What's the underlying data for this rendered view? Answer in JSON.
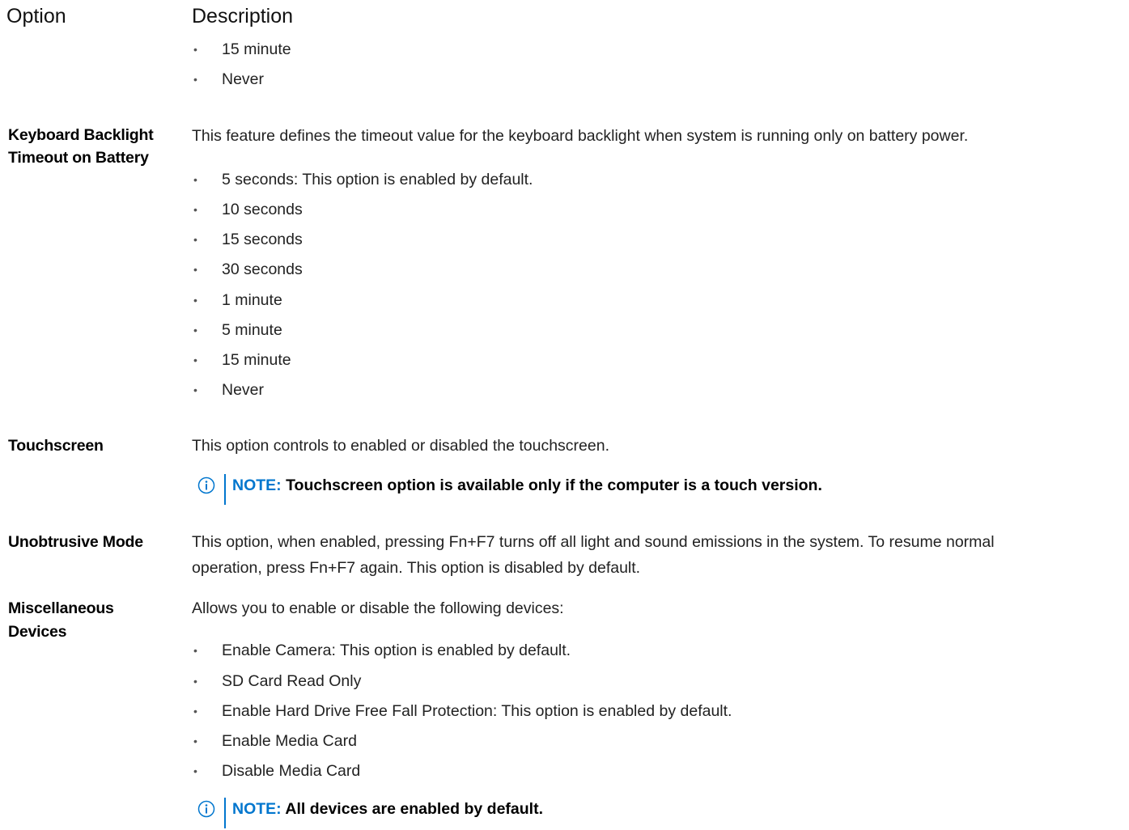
{
  "header": {
    "option": "Option",
    "description": "Description"
  },
  "top_bullets": [
    "15 minute",
    "Never"
  ],
  "rows": [
    {
      "option_lines": [
        "Keyboard Backlight",
        "Timeout on Battery"
      ],
      "description": "This feature defines the timeout value for the keyboard backlight when system is running only on battery power.",
      "bullets": [
        "5 seconds: This option is enabled by default.",
        "10 seconds",
        "15 seconds",
        "30 seconds",
        "1 minute",
        "5 minute",
        "15 minute",
        "Never"
      ]
    },
    {
      "option_lines": [
        "Touchscreen"
      ],
      "description": "This option controls to enabled or disabled the touchscreen.",
      "note": {
        "label": "NOTE:",
        "text": "Touchscreen option is available only if the computer is a touch version."
      }
    },
    {
      "option_lines": [
        "Unobtrusive Mode"
      ],
      "description_lines": [
        "This option, when enabled, pressing Fn+F7 turns off all light and sound emissions in the system. To resume normal",
        "operation, press Fn+F7 again. This option is disabled by default."
      ]
    },
    {
      "option_lines": [
        "Miscellaneous",
        "Devices"
      ],
      "description": "Allows you to enable or disable the following devices:",
      "bullets": [
        "Enable Camera: This option is enabled by default.",
        "SD Card Read Only",
        "Enable Hard Drive Free Fall Protection: This option is enabled by default.",
        "Enable Media Card",
        "Disable Media Card"
      ],
      "note": {
        "label": "NOTE:",
        "text": "All devices are enabled by default."
      }
    }
  ],
  "colors": {
    "note_accent": "#0076ce"
  },
  "icons": {
    "note": "info-icon"
  }
}
